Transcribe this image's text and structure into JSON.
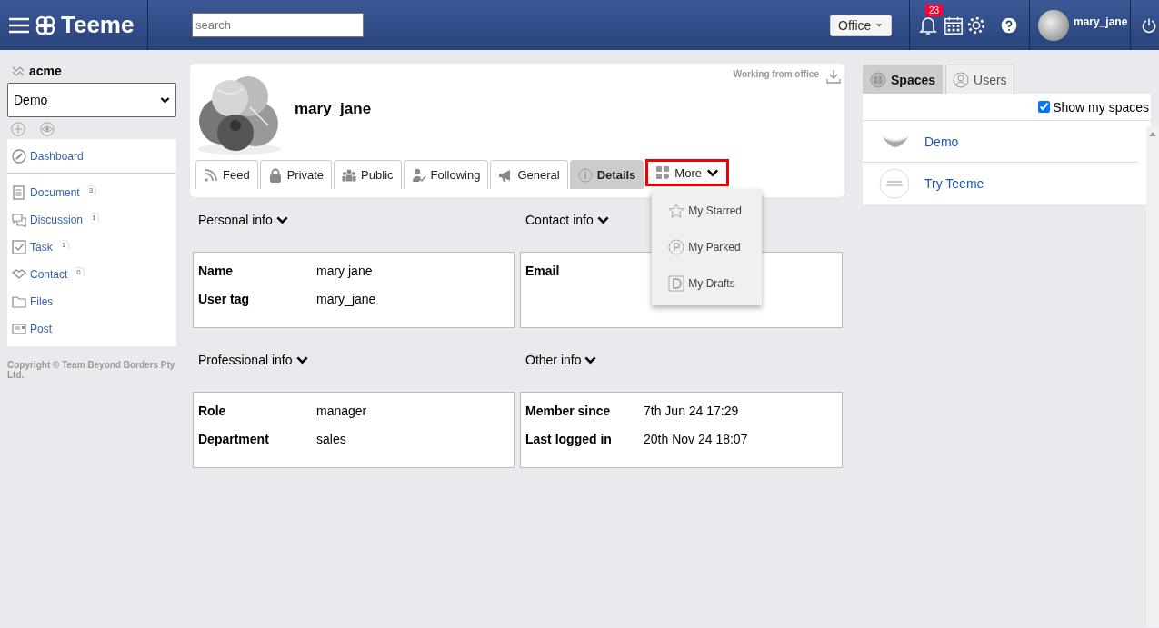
{
  "header": {
    "logo": "Teeme",
    "search": {
      "placeholder": "search"
    },
    "location": "Office",
    "notifications": "23",
    "user": "mary_jane"
  },
  "sidebar": {
    "org": "acme",
    "space_select": "Demo",
    "items": [
      {
        "label": "Dashboard"
      },
      {
        "label": "Document",
        "count": "3"
      },
      {
        "label": "Discussion",
        "count": "1"
      },
      {
        "label": "Task",
        "count": "1"
      },
      {
        "label": "Contact",
        "count": "0"
      },
      {
        "label": "Files"
      },
      {
        "label": "Post"
      }
    ],
    "copyright": "Copyright © Team Beyond Borders Pty Ltd."
  },
  "profile": {
    "name": "mary_jane",
    "status": "Working from office",
    "tabs": [
      {
        "label": "Feed",
        "selected": false,
        "highlighted": false
      },
      {
        "label": "Private",
        "selected": false,
        "highlighted": false
      },
      {
        "label": "Public",
        "selected": false,
        "highlighted": false
      },
      {
        "label": "Following",
        "selected": false,
        "highlighted": false
      },
      {
        "label": "General",
        "selected": false,
        "highlighted": false
      },
      {
        "label": "Details",
        "selected": true,
        "highlighted": false
      },
      {
        "label": "More",
        "selected": false,
        "highlighted": true,
        "expanded": true
      }
    ],
    "more_menu": [
      {
        "label": "My Starred"
      },
      {
        "label": "My Parked"
      },
      {
        "label": "My Drafts"
      }
    ],
    "sections": [
      {
        "title": "Personal info",
        "fields": [
          {
            "label": "Name",
            "value": "mary jane"
          },
          {
            "label": "User tag",
            "value": "mary_jane"
          }
        ]
      },
      {
        "title": "Contact info",
        "fields": [
          {
            "label": "Email"
          }
        ]
      },
      {
        "title": "Professional info",
        "fields": [
          {
            "label": "Role",
            "value": "manager"
          },
          {
            "label": "Department",
            "value": "sales"
          }
        ]
      },
      {
        "title": "Other info",
        "fields": [
          {
            "label": "Member since",
            "value": "7th Jun 24 17:29"
          },
          {
            "label": "Last logged in",
            "value": "20th Nov 24 18:07"
          }
        ]
      }
    ]
  },
  "right_panel": {
    "tabs": [
      {
        "label": "Spaces",
        "selected": true
      },
      {
        "label": "Users",
        "selected": false
      }
    ],
    "show_my_spaces": {
      "label": "Show my spaces",
      "checked": true
    },
    "spaces": [
      {
        "name": "Demo",
        "kind": "picture"
      },
      {
        "name": "Try Teeme",
        "kind": "placeholder"
      }
    ]
  }
}
